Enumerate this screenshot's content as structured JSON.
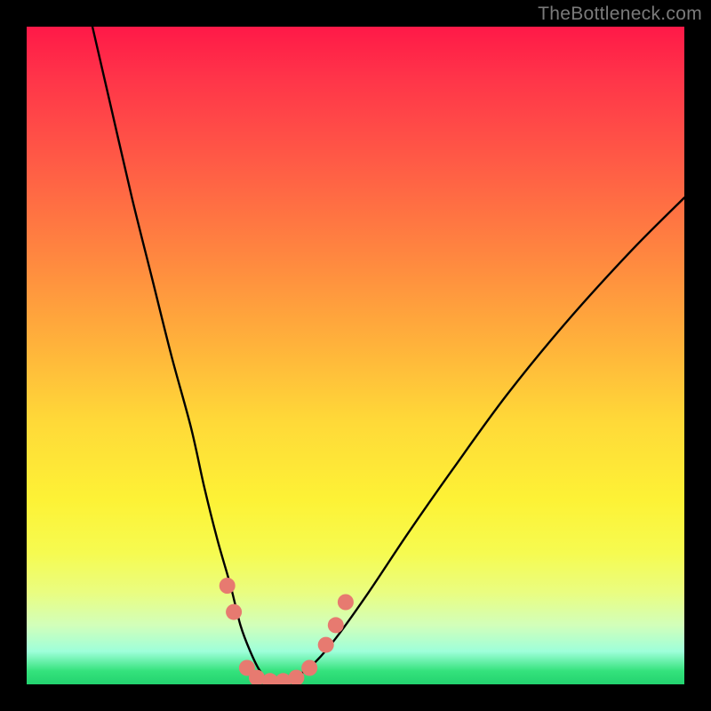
{
  "watermark": "TheBottleneck.com",
  "colors": {
    "background": "#000000",
    "gradient_top": "#ff1948",
    "gradient_bottom": "#23d36f",
    "curve": "#000000",
    "markers": "#e77a70",
    "watermark_text": "#7a7a7a"
  },
  "chart_data": {
    "type": "line",
    "title": "",
    "xlabel": "",
    "ylabel": "",
    "xlim": [
      0,
      100
    ],
    "ylim": [
      0,
      100
    ],
    "grid": false,
    "legend": false,
    "series": [
      {
        "name": "bottleneck-curve",
        "x": [
          10,
          13,
          16,
          19,
          22,
          25,
          27,
          29,
          31,
          32.5,
          34,
          35.5,
          37,
          39,
          41.5,
          44,
          47,
          52,
          58,
          65,
          73,
          82,
          92,
          100
        ],
        "y": [
          100,
          87,
          74,
          62,
          50,
          39,
          30,
          22,
          15,
          9,
          5,
          2,
          0.5,
          0.5,
          1.5,
          3.5,
          7,
          14,
          23,
          33,
          44,
          55,
          66,
          74
        ]
      }
    ],
    "markers": [
      {
        "x": 30.5,
        "y": 15
      },
      {
        "x": 31.5,
        "y": 11
      },
      {
        "x": 33.5,
        "y": 2.5
      },
      {
        "x": 35,
        "y": 1
      },
      {
        "x": 37,
        "y": 0.5
      },
      {
        "x": 39,
        "y": 0.5
      },
      {
        "x": 41,
        "y": 1
      },
      {
        "x": 43,
        "y": 2.5
      },
      {
        "x": 45.5,
        "y": 6
      },
      {
        "x": 47,
        "y": 9
      },
      {
        "x": 48.5,
        "y": 12.5
      }
    ],
    "marker_radius_px": 9
  }
}
